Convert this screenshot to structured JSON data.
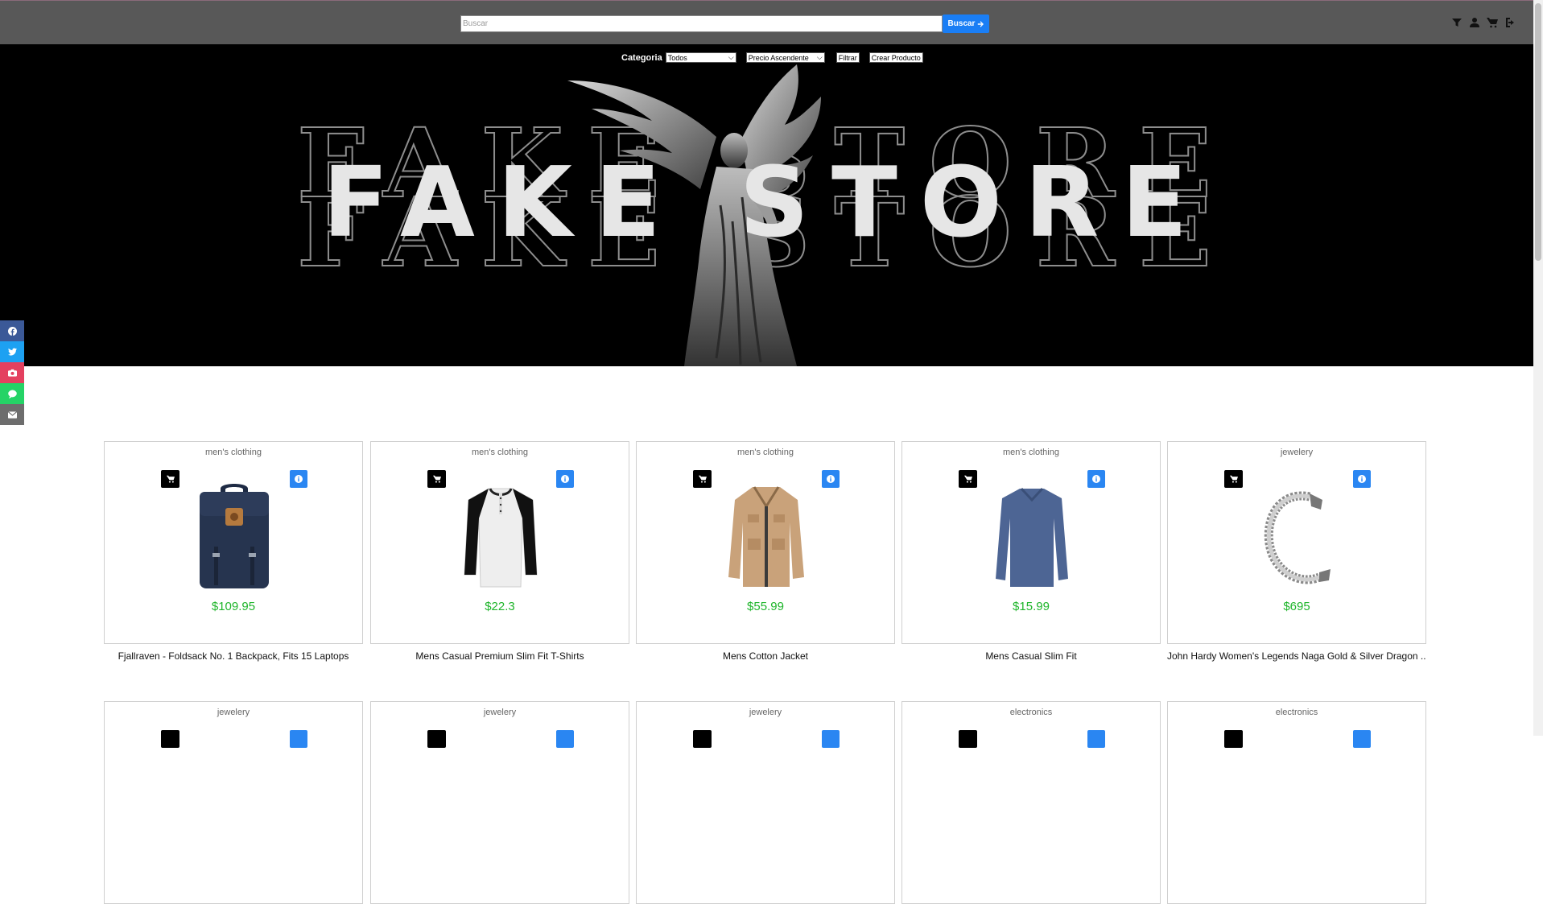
{
  "search": {
    "placeholder": "Buscar",
    "button_label": "Buscar"
  },
  "filters": {
    "category_label": "Categoria",
    "category_value": "Todos",
    "sort_value": "Precio Ascendente",
    "filter_button": "Filtrar",
    "create_button": "Crear Producto"
  },
  "hero": {
    "title": "FAKE STORE"
  },
  "products": [
    {
      "category": "men's clothing",
      "price": "$109.95",
      "title": "Fjallraven - Foldsack No. 1 Backpack, Fits 15 Laptops",
      "image": "backpack"
    },
    {
      "category": "men's clothing",
      "price": "$22.3",
      "title": "Mens Casual Premium Slim Fit T-Shirts",
      "image": "raglan-shirt"
    },
    {
      "category": "men's clothing",
      "price": "$55.99",
      "title": "Mens Cotton Jacket",
      "image": "jacket"
    },
    {
      "category": "men's clothing",
      "price": "$15.99",
      "title": "Mens Casual Slim Fit",
      "image": "long-sleeve-shirt"
    },
    {
      "category": "jewelery",
      "price": "$695",
      "title": "John Hardy Women's Legends Naga Gold & Silver Dragon ...",
      "image": "bracelet"
    }
  ],
  "products_row2": [
    {
      "category": "jewelery"
    },
    {
      "category": "jewelery"
    },
    {
      "category": "jewelery"
    },
    {
      "category": "electronics"
    },
    {
      "category": "electronics"
    }
  ],
  "colors": {
    "topbar": "#585858",
    "accent": "#1a7ef5",
    "price": "#1fb52b"
  }
}
